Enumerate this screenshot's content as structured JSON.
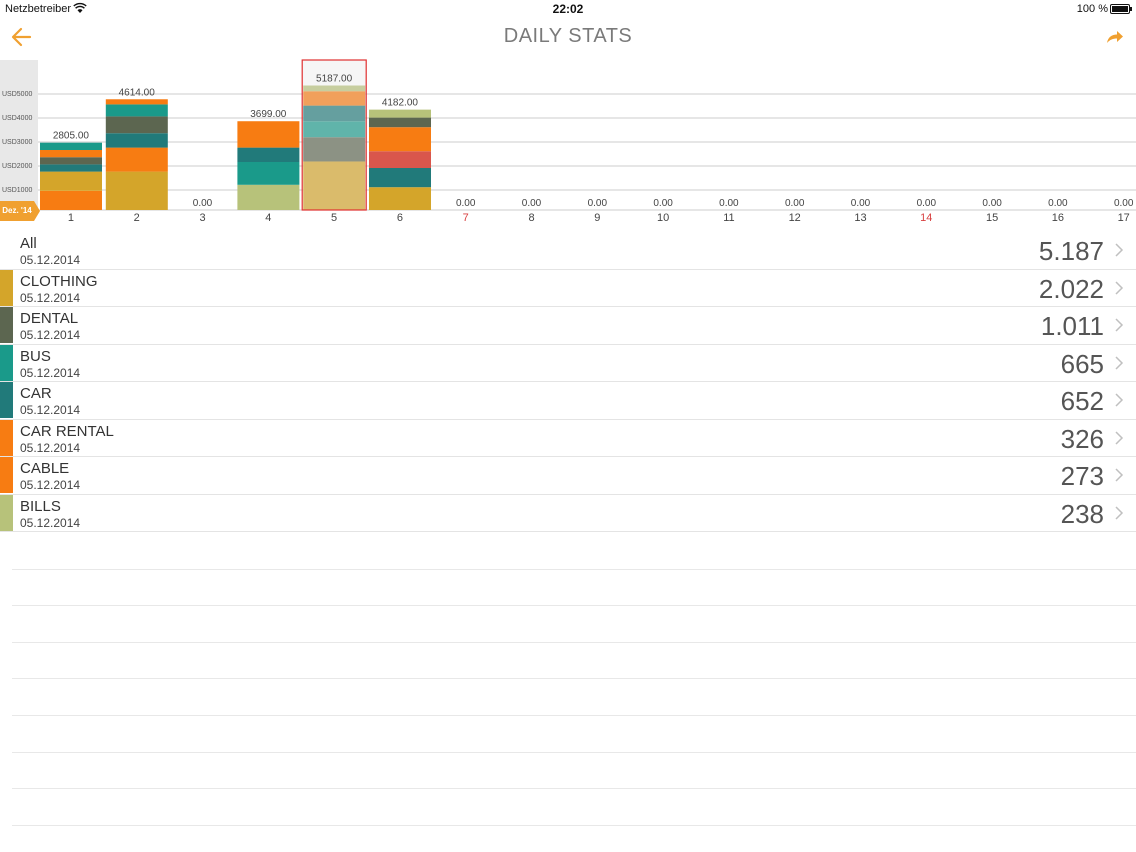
{
  "status": {
    "carrier": "Netzbetreiber",
    "time": "22:02",
    "battery": "100 %"
  },
  "nav": {
    "title": "DAILY STATS"
  },
  "colors": {
    "accent": "#f0a030",
    "CLOTHING": "#d4a52a",
    "DENTAL": "#5c6650",
    "BUS": "#1a9a8a",
    "CAR": "#217a7a",
    "CAR RENTAL": "#f77c12",
    "CABLE": "#f77c12",
    "BILLS": "#b7c27a",
    "OTHER_RED": "#d9564c",
    "weekend_label": "#d84040"
  },
  "chart_data": {
    "type": "bar",
    "stacked": true,
    "month_label": "Dez. '14",
    "y_tick_labels": [
      "USD1000",
      "USD2000",
      "USD3000",
      "USD4000",
      "USD5000"
    ],
    "ylim": [
      0,
      5500
    ],
    "grid": true,
    "selected_day": "5",
    "days": [
      {
        "day": "1",
        "total": "2805.00",
        "weekend": false
      },
      {
        "day": "2",
        "total": "4614.00",
        "weekend": false
      },
      {
        "day": "3",
        "total": "0.00",
        "weekend": false
      },
      {
        "day": "4",
        "total": "3699.00",
        "weekend": false
      },
      {
        "day": "5",
        "total": "5187.00",
        "weekend": false
      },
      {
        "day": "6",
        "total": "4182.00",
        "weekend": false
      },
      {
        "day": "7",
        "total": "0.00",
        "weekend": true
      },
      {
        "day": "8",
        "total": "0.00",
        "weekend": false
      },
      {
        "day": "9",
        "total": "0.00",
        "weekend": false
      },
      {
        "day": "10",
        "total": "0.00",
        "weekend": false
      },
      {
        "day": "11",
        "total": "0.00",
        "weekend": false
      },
      {
        "day": "12",
        "total": "0.00",
        "weekend": false
      },
      {
        "day": "13",
        "total": "0.00",
        "weekend": false
      },
      {
        "day": "14",
        "total": "0.00",
        "weekend": true
      },
      {
        "day": "15",
        "total": "0.00",
        "weekend": false
      },
      {
        "day": "16",
        "total": "0.00",
        "weekend": false
      },
      {
        "day": "17",
        "total": "0.00",
        "weekend": false
      }
    ],
    "segments": {
      "1": [
        [
          "#f77c12",
          800
        ],
        [
          "#d4a52a",
          800
        ],
        [
          "#217a7a",
          300
        ],
        [
          "#5c6650",
          300
        ],
        [
          "#f77c12",
          300
        ],
        [
          "#1a9a8a",
          305
        ]
      ],
      "2": [
        [
          "#d4a52a",
          1600
        ],
        [
          "#f77c12",
          1000
        ],
        [
          "#217a7a",
          600
        ],
        [
          "#5c6650",
          700
        ],
        [
          "#1a9a8a",
          500
        ],
        [
          "#f77c12",
          214
        ]
      ],
      "4": [
        [
          "#b7c27a",
          1050
        ],
        [
          "#1a9a8a",
          950
        ],
        [
          "#217a7a",
          600
        ],
        [
          "#f77c12",
          1099
        ]
      ],
      "5": [
        [
          "#d4a52a",
          2022
        ],
        [
          "#5c6650",
          1011
        ],
        [
          "#1a9a8a",
          665
        ],
        [
          "#217a7a",
          652
        ],
        [
          "#f77c12",
          599
        ],
        [
          "#b7c27a",
          238
        ]
      ],
      "6": [
        [
          "#d4a52a",
          950
        ],
        [
          "#217a7a",
          800
        ],
        [
          "#d9564c",
          700
        ],
        [
          "#f77c12",
          1000
        ],
        [
          "#5c6650",
          400
        ],
        [
          "#b7c27a",
          332
        ]
      ]
    }
  },
  "list": [
    {
      "label": "All",
      "date": "05.12.2014",
      "value": "5.187",
      "color": ""
    },
    {
      "label": "CLOTHING",
      "date": "05.12.2014",
      "value": "2.022",
      "color": "#d4a52a"
    },
    {
      "label": "DENTAL",
      "date": "05.12.2014",
      "value": "1.011",
      "color": "#5c6650"
    },
    {
      "label": "BUS",
      "date": "05.12.2014",
      "value": "665",
      "color": "#1a9a8a"
    },
    {
      "label": "CAR",
      "date": "05.12.2014",
      "value": "652",
      "color": "#217a7a"
    },
    {
      "label": "CAR RENTAL",
      "date": "05.12.2014",
      "value": "326",
      "color": "#f77c12"
    },
    {
      "label": "CABLE",
      "date": "05.12.2014",
      "value": "273",
      "color": "#f77c12"
    },
    {
      "label": "BILLS",
      "date": "05.12.2014",
      "value": "238",
      "color": "#b7c27a"
    }
  ]
}
